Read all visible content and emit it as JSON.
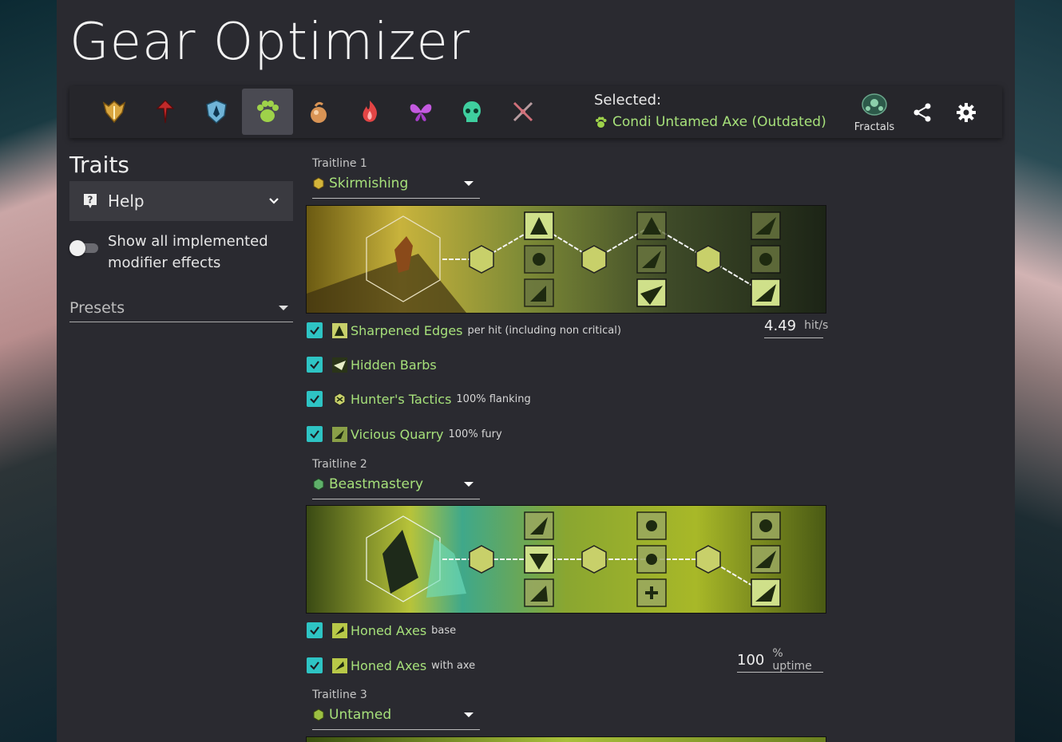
{
  "app": {
    "title": "Gear Optimizer"
  },
  "professions": [
    {
      "name": "guardian-icon",
      "color": "#d9a640"
    },
    {
      "name": "revenant-icon",
      "color": "#c12a2a"
    },
    {
      "name": "warrior-icon",
      "color": "#6fb3d7"
    },
    {
      "name": "ranger-icon",
      "color": "#9ed24a",
      "selected": true
    },
    {
      "name": "thief-icon",
      "color": "#d99455"
    },
    {
      "name": "engineer-icon",
      "color": "#e34545"
    },
    {
      "name": "elementalist-icon",
      "color": "#c45ae0"
    },
    {
      "name": "necromancer-icon",
      "color": "#3fcf9f"
    },
    {
      "name": "mesmer-icon",
      "color": "#d0707a"
    }
  ],
  "selected": {
    "label": "Selected:",
    "value": "Condi Untamed Axe (Outdated)"
  },
  "game_mode": {
    "label": "Fractals"
  },
  "traits": {
    "heading": "Traits"
  },
  "help": {
    "label": "Help"
  },
  "toggle": {
    "label_line1": "Show all implemented",
    "label_line2": "modifier effects"
  },
  "presets": {
    "label": "Presets"
  },
  "traitlines": [
    {
      "label": "Traitline 1",
      "value": "Skirmishing"
    },
    {
      "label": "Traitline 2",
      "value": "Beastmastery"
    },
    {
      "label": "Traitline 3",
      "value": "Untamed"
    }
  ],
  "modifiers": [
    {
      "name": "Sharpened Edges",
      "note": "per hit (including non critical)",
      "checked": true
    },
    {
      "name": "Hidden Barbs",
      "note": "",
      "checked": true
    },
    {
      "name": "Hunter's Tactics",
      "note": "100% flanking",
      "checked": true
    },
    {
      "name": "Vicious Quarry",
      "note": "100% fury",
      "checked": true
    },
    {
      "name": "Honed Axes",
      "note": "base",
      "checked": true
    },
    {
      "name": "Honed Axes",
      "note": "with axe",
      "checked": true
    }
  ],
  "fields": {
    "hits": {
      "value": "4.49",
      "unit": "hit/s"
    },
    "uptime": {
      "value": "100",
      "unit": "% uptime"
    }
  },
  "colors": {
    "accent": "#a6e07a",
    "checkbox": "#2ec4c4",
    "panel": "#2a2a30"
  }
}
